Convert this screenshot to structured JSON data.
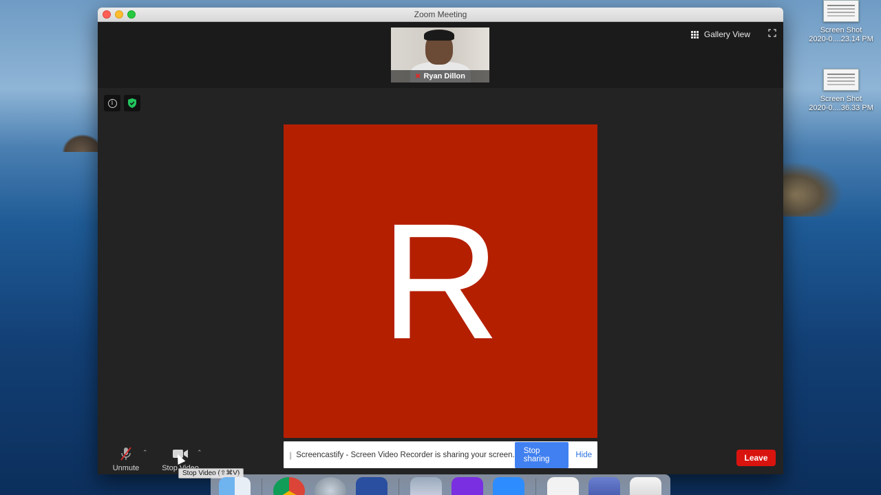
{
  "desktop": {
    "icons": [
      {
        "line1": "Screen Shot",
        "line2": "2020-0....23.14 PM"
      },
      {
        "line1": "Screen Shot",
        "line2": "2020-0....36.33 PM"
      }
    ]
  },
  "window": {
    "title": "Zoom Meeting"
  },
  "gallery": {
    "label": "Gallery View"
  },
  "participant": {
    "name": "Ryan Dillon"
  },
  "speaker": {
    "initial": "R",
    "tile_color": "#b41f00"
  },
  "toolbar": {
    "unmute_label": "Unmute",
    "stop_video_label": "Stop Video",
    "tooltip": "Stop Video (⇧⌘V)",
    "leave_label": "Leave"
  },
  "share_notice": {
    "text": "Screencastify - Screen Video Recorder is sharing your screen.",
    "stop_label": "Stop sharing",
    "hide_label": "Hide"
  },
  "colors": {
    "leave": "#d9140f",
    "stop_sharing": "#4180f0",
    "security_shield": "#22c55e"
  },
  "dock": {
    "apps": [
      "finder-icon",
      "chrome-icon",
      "launchpad-icon",
      "kipp-app-icon",
      "preview-icon",
      "imovie-icon",
      "zoom-icon",
      "document-icon",
      "screenshot-icon",
      "trash-icon"
    ]
  }
}
